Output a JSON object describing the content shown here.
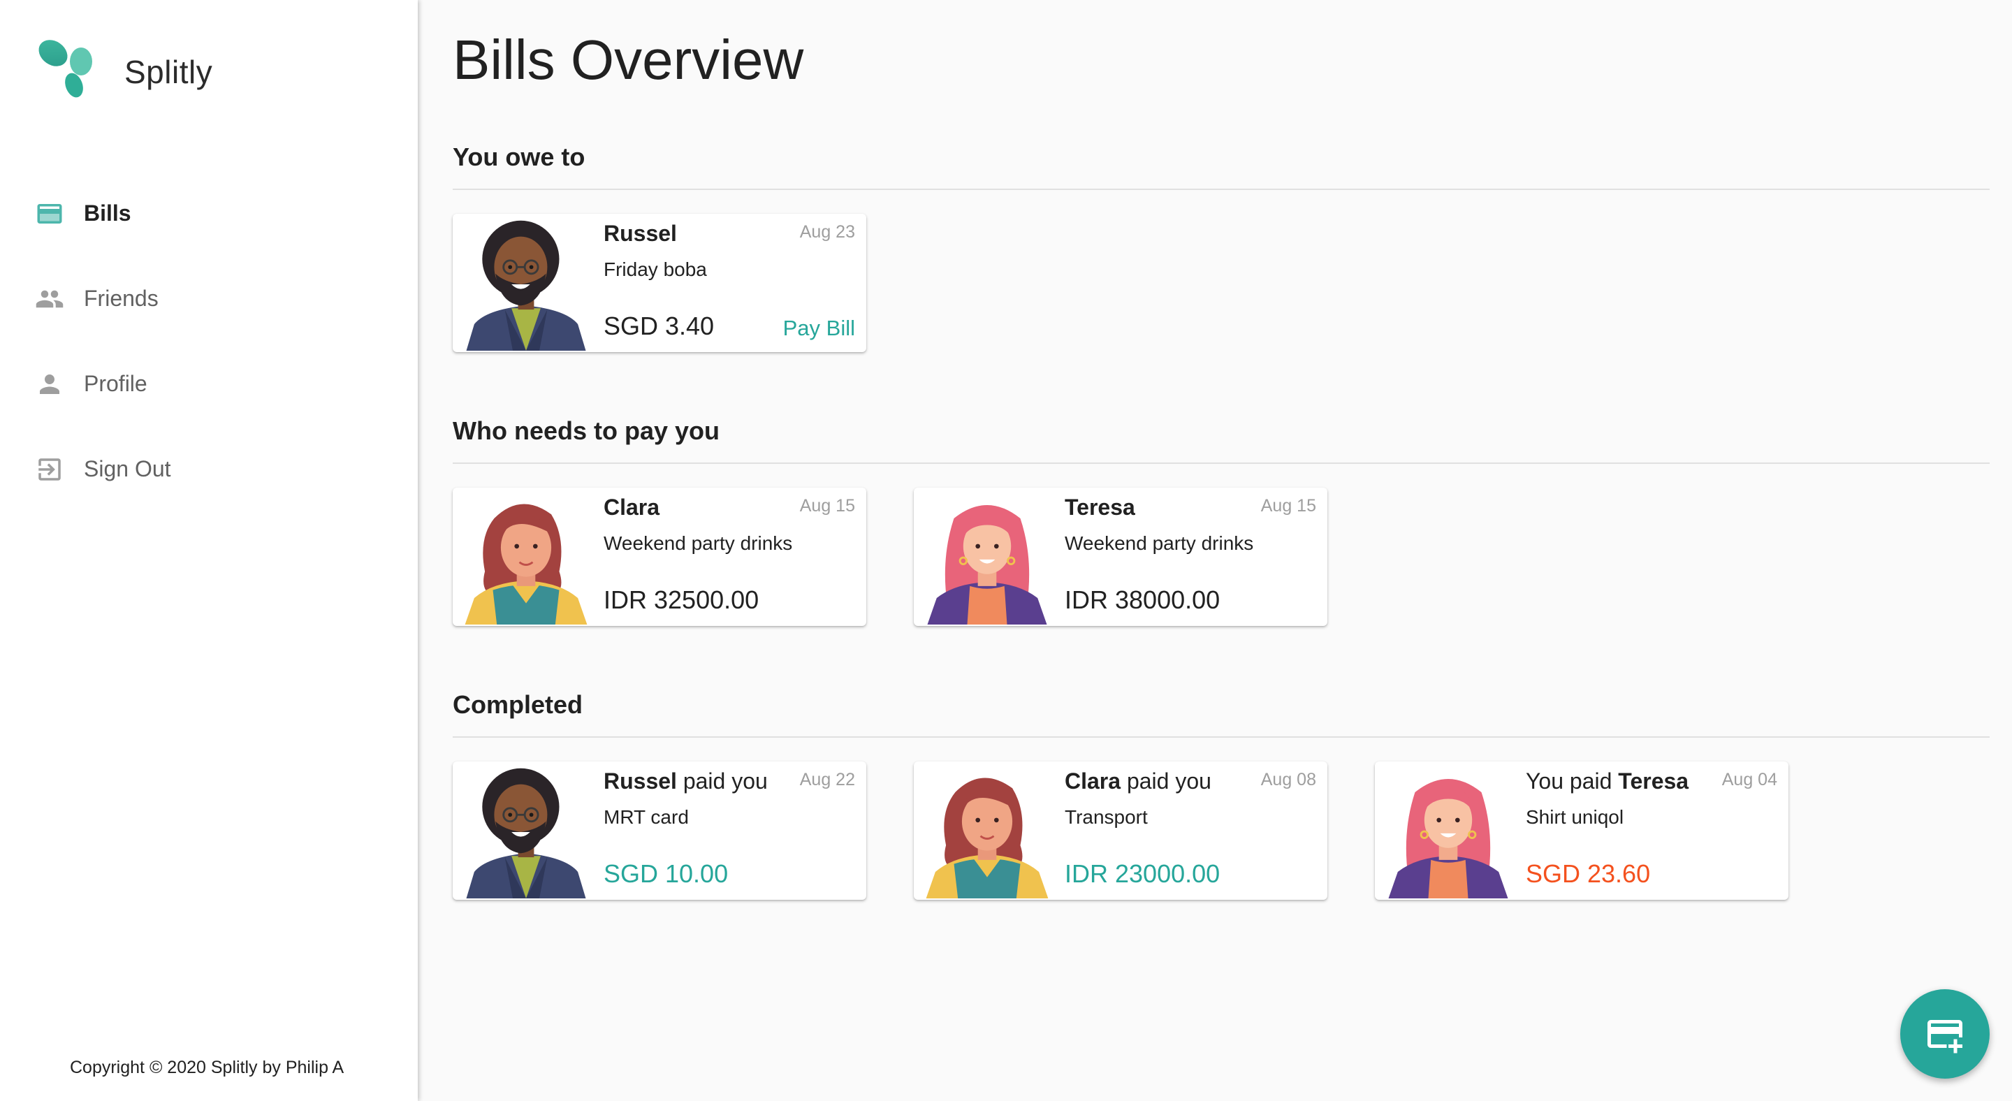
{
  "app": {
    "name": "Splitly"
  },
  "sidebar": {
    "items": [
      {
        "label": "Bills",
        "icon": "credit-card-icon",
        "active": true
      },
      {
        "label": "Friends",
        "icon": "people-icon",
        "active": false
      },
      {
        "label": "Profile",
        "icon": "person-icon",
        "active": false
      },
      {
        "label": "Sign Out",
        "icon": "exit-icon",
        "active": false
      }
    ],
    "copyright": "Copyright © 2020 Splitly by Philip A"
  },
  "page": {
    "title": "Bills Overview"
  },
  "sections": {
    "owe": {
      "title": "You owe to",
      "cards": [
        {
          "name": "Russel",
          "date": "Aug 23",
          "desc": "Friday boba",
          "amount": "SGD 3.40",
          "action": "Pay Bill",
          "avatar": "russel-avatar"
        }
      ]
    },
    "receivable": {
      "title": "Who needs to pay you",
      "cards": [
        {
          "name": "Clara",
          "date": "Aug 15",
          "desc": "Weekend party drinks",
          "amount": "IDR 32500.00",
          "avatar": "clara-avatar"
        },
        {
          "name": "Teresa",
          "date": "Aug 15",
          "desc": "Weekend party drinks",
          "amount": "IDR 38000.00",
          "avatar": "teresa-avatar"
        }
      ]
    },
    "completed": {
      "title": "Completed",
      "cards": [
        {
          "name_bold": "Russel",
          "name_rest": " paid you",
          "date": "Aug 22",
          "desc": "MRT card",
          "amount": "SGD 10.00",
          "status_color": "#26a69a",
          "avatar": "russel-avatar"
        },
        {
          "name_bold": "Clara",
          "name_rest": " paid you",
          "date": "Aug 08",
          "desc": "Transport",
          "amount": "IDR 23000.00",
          "status_color": "#26a69a",
          "avatar": "clara-avatar"
        },
        {
          "name_prefix": "You paid ",
          "name_bold": "Teresa",
          "date": "Aug 04",
          "desc": "Shirt uniqol",
          "amount": "SGD 23.60",
          "status_color": "#f4511e",
          "avatar": "teresa-avatar"
        }
      ]
    }
  },
  "fab": {
    "icon": "add-bill-icon"
  },
  "colors": {
    "accent": "#26a69a",
    "negative": "#f4511e",
    "text": "#212121",
    "muted": "#9e9e9e"
  }
}
